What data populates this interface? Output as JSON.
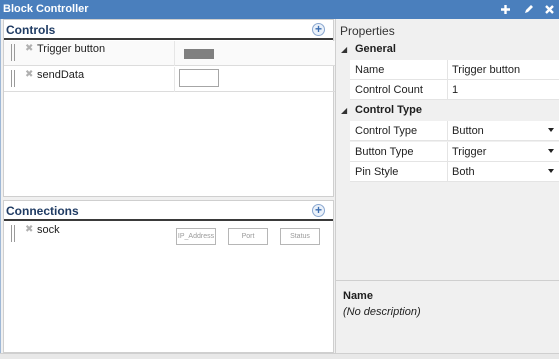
{
  "window": {
    "title": "Block Controller",
    "buttons": [
      {
        "icon": "plus-icon"
      },
      {
        "icon": "pencil-icon"
      },
      {
        "icon": "close-icon"
      }
    ]
  },
  "controls": {
    "header": "Controls",
    "items": [
      {
        "label": "Trigger button",
        "widget": "gray-swatch"
      },
      {
        "label": "sendData",
        "widget": "text-box"
      }
    ]
  },
  "connections": {
    "header": "Connections",
    "items": [
      {
        "label": "sock",
        "fields": {
          "ip": "IP_Address",
          "port": "Port",
          "status": "Status"
        }
      }
    ]
  },
  "properties": {
    "title": "Properties",
    "categories": [
      {
        "name": "General",
        "rows": [
          {
            "name": "Name",
            "value": "Trigger button"
          },
          {
            "name": "Control Count",
            "value": "1"
          }
        ]
      },
      {
        "name": "Control Type",
        "rows": [
          {
            "name": "Control Type",
            "value": "Button"
          },
          {
            "name": "Button Type",
            "value": "Trigger"
          },
          {
            "name": "Pin Style",
            "value": "Both"
          }
        ]
      }
    ],
    "description": {
      "name": "Name",
      "text": "(No description)"
    }
  },
  "colors": {
    "titlebar": "#4a7fbd",
    "section_header_text": "#1f3b63"
  }
}
